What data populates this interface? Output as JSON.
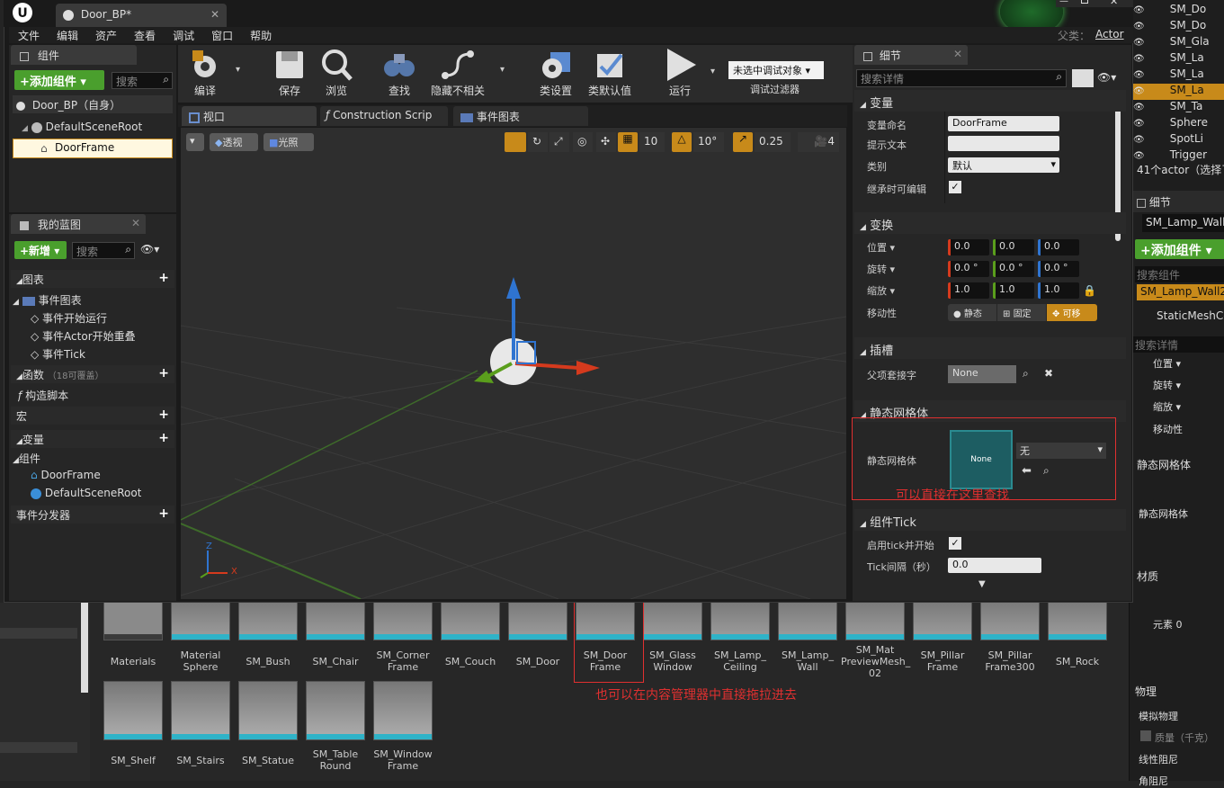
{
  "window": {
    "doc_tab": "Door_BP*",
    "parent_label": "父类：",
    "parent_value": "Actor"
  },
  "menu": [
    "文件",
    "编辑",
    "资产",
    "查看",
    "调试",
    "窗口",
    "帮助"
  ],
  "components_panel": {
    "title": "组件",
    "add_button": "+添加组件 ▾",
    "search_placeholder": "搜索",
    "root": "Door_BP（自身）",
    "scene_root": "DefaultSceneRoot",
    "selected": "DoorFrame"
  },
  "my_blueprint": {
    "title": "我的蓝图",
    "new_button": "+新增 ▾",
    "search_placeholder": "搜索",
    "graphs_label": "图表",
    "event_graph": "事件图表",
    "events": [
      "事件开始运行",
      "事件Actor开始重叠",
      "事件Tick"
    ],
    "functions_label": "函数",
    "functions_override": "（18可覆盖）",
    "construction_script": "构造脚本",
    "macros_label": "宏",
    "variables_label": "变量",
    "components_label": "组件",
    "component_vars": [
      "DoorFrame",
      "DefaultSceneRoot"
    ],
    "dispatchers_label": "事件分发器"
  },
  "toolbar": {
    "compile": "编译",
    "save": "保存",
    "browse": "浏览",
    "find": "查找",
    "hide_unrelated": "隐藏不相关",
    "class_settings": "类设置",
    "class_defaults": "类默认值",
    "play": "运行",
    "debug_object": "未选中调试对象 ▾",
    "debug_filter": "调试过滤器"
  },
  "editor_tabs": [
    "视口",
    "Construction Scrip",
    "事件图表"
  ],
  "viewport": {
    "perspective": "透视",
    "lit": "光照",
    "grid_snap": "10",
    "rot_snap": "10°",
    "scale_snap": "0.25",
    "cam_speed": "4",
    "axis_x": "X",
    "axis_z": "Z"
  },
  "details": {
    "title": "细节",
    "search_placeholder": "搜索详情",
    "variable": {
      "header": "变量",
      "name_label": "变量命名",
      "name_value": "DoorFrame",
      "tooltip_label": "提示文本",
      "tooltip_value": "",
      "category_label": "类别",
      "category_value": "默认",
      "editable_label": "继承时可编辑"
    },
    "transform": {
      "header": "变换",
      "location_label": "位置 ▾",
      "location": [
        "0.0",
        "0.0",
        "0.0"
      ],
      "rotation_label": "旋转 ▾",
      "rotation": [
        "0.0 °",
        "0.0 °",
        "0.0 °"
      ],
      "scale_label": "缩放 ▾",
      "scale": [
        "1.0",
        "1.0",
        "1.0"
      ],
      "mobility_label": "移动性",
      "mobility": [
        "静态",
        "固定",
        "可移"
      ]
    },
    "socket": {
      "header": "插槽",
      "parent_socket_label": "父项套接字",
      "parent_socket_value": "None"
    },
    "static_mesh": {
      "header": "静态网格体",
      "label": "静态网格体",
      "thumb_text": "None",
      "select_value": "无"
    },
    "annotation_mesh": "可以直接在这里查找",
    "tick": {
      "header": "组件Tick",
      "enabled_label": "启用tick并开始",
      "interval_label": "Tick间隔（秒）",
      "interval_value": "0.0"
    }
  },
  "content_browser": {
    "annotation": "也可以在内容管理器中直接拖拉进去",
    "row1": [
      "Materials",
      "Material Sphere",
      "SM_Bush",
      "SM_Chair",
      "SM_Corner Frame",
      "SM_Couch",
      "SM_Door",
      "SM_Door Frame",
      "SM_Glass Window",
      "SM_Lamp_ Ceiling",
      "SM_Lamp_ Wall",
      "SM_Mat PreviewMesh_ 02",
      "SM_Pillar Frame",
      "SM_Pillar Frame300",
      "SM_Rock"
    ],
    "row2": [
      "SM_Shelf",
      "SM_Stairs",
      "SM_Statue",
      "SM_Table Round",
      "SM_Window Frame"
    ]
  },
  "outliner_bg": {
    "items": [
      "SM_Do",
      "SM_Do",
      "SM_Gla",
      "SM_La",
      "SM_La",
      "SM_La",
      "SM_Ta",
      "Sphere",
      "SpotLi",
      "Trigger"
    ],
    "count": "41个actor（选择了",
    "details_title": "细节",
    "selected_actor": "SM_Lamp_Wall2",
    "add_component": "+添加组件 ▾",
    "search_components": "搜索组件",
    "component_root": "SM_Lamp_Wall2",
    "mesh_component": "StaticMeshCo",
    "search_details": "搜索详情",
    "props": [
      "位置 ▾",
      "旋转 ▾",
      "缩放 ▾",
      "移动性"
    ],
    "static_mesh_header": "静态网格体",
    "static_mesh_label": "静态网格体",
    "materials_header": "材质",
    "elements": "元素 0",
    "physics_header": "物理",
    "simulate": "模拟物理",
    "mass": "质量（千克）",
    "linear_damping": "线性阻尼",
    "angular_damping": "角阻尼"
  },
  "colors": {
    "accent_green": "#4a9f2d",
    "selection_orange": "#c88a1a",
    "annotation_red": "#e03030",
    "x_red": "#d53a1d",
    "y_green": "#5a9e1c",
    "z_blue": "#2f74d0"
  }
}
